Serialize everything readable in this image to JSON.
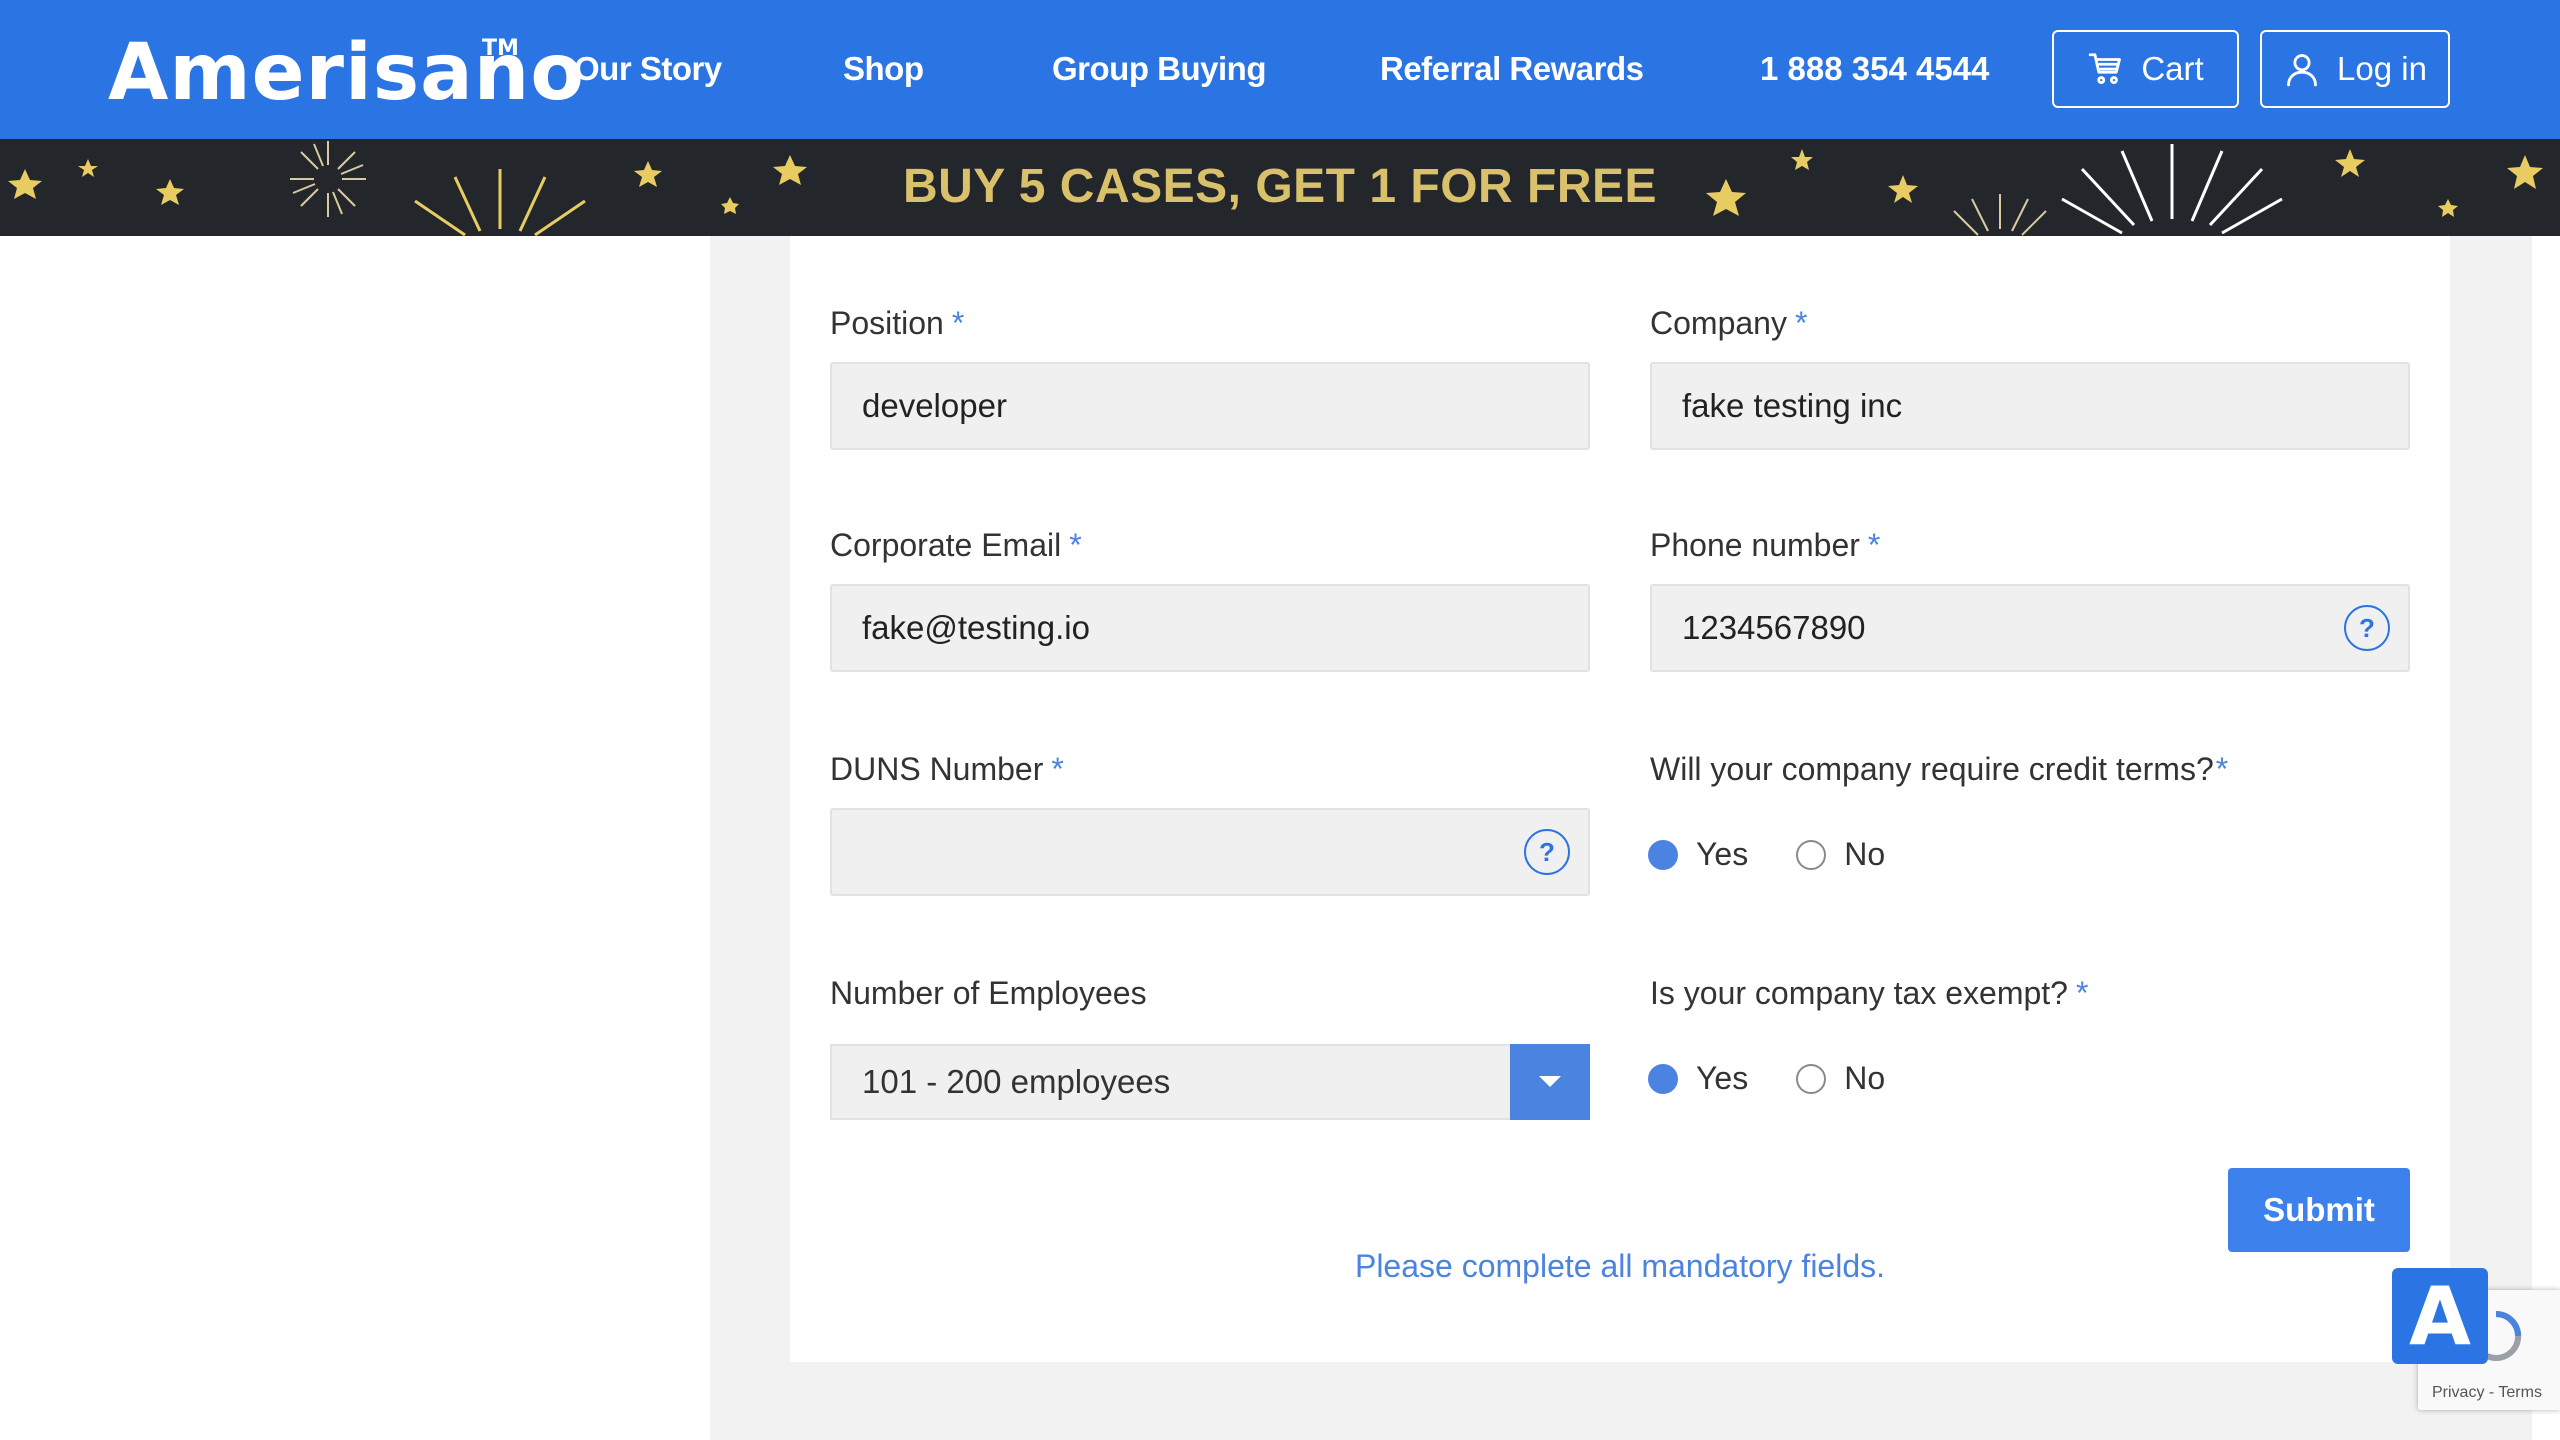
{
  "header": {
    "brand": "Amerisano",
    "trademark": "TM",
    "nav": [
      "Our Story",
      "Shop",
      "Group Buying",
      "Referral Rewards"
    ],
    "phone": "1 888 354 4544",
    "cart_label": "Cart",
    "login_label": "Log in"
  },
  "promo": {
    "text": "BUY 5 CASES, GET 1 FOR FREE"
  },
  "form": {
    "required_mark": "*",
    "position": {
      "label": "Position",
      "value": "developer"
    },
    "company": {
      "label": "Company",
      "value": "fake testing inc"
    },
    "email": {
      "label": "Corporate Email",
      "value": "fake@testing.io"
    },
    "phone": {
      "label": "Phone number",
      "value": "1234567890",
      "help": "?"
    },
    "duns": {
      "label": "DUNS Number",
      "value": "",
      "help": "?"
    },
    "credit_terms": {
      "label": "Will your company require credit terms?",
      "yes": "Yes",
      "no": "No",
      "selected": "Yes"
    },
    "employees": {
      "label": "Number of Employees",
      "selected": "101 - 200 employees"
    },
    "tax_exempt": {
      "label": "Is your company tax exempt?",
      "yes": "Yes",
      "no": "No",
      "selected": "Yes"
    },
    "submit_label": "Submit",
    "notice": "Please complete all mandatory fields."
  },
  "widgets": {
    "accessibility_letter": "A",
    "recaptcha_links": "Privacy - Terms"
  },
  "colors": {
    "header_bg": "#2b74e3",
    "banner_bg": "#23262b",
    "banner_text": "#d9c06a",
    "accent": "#4a84e0"
  }
}
